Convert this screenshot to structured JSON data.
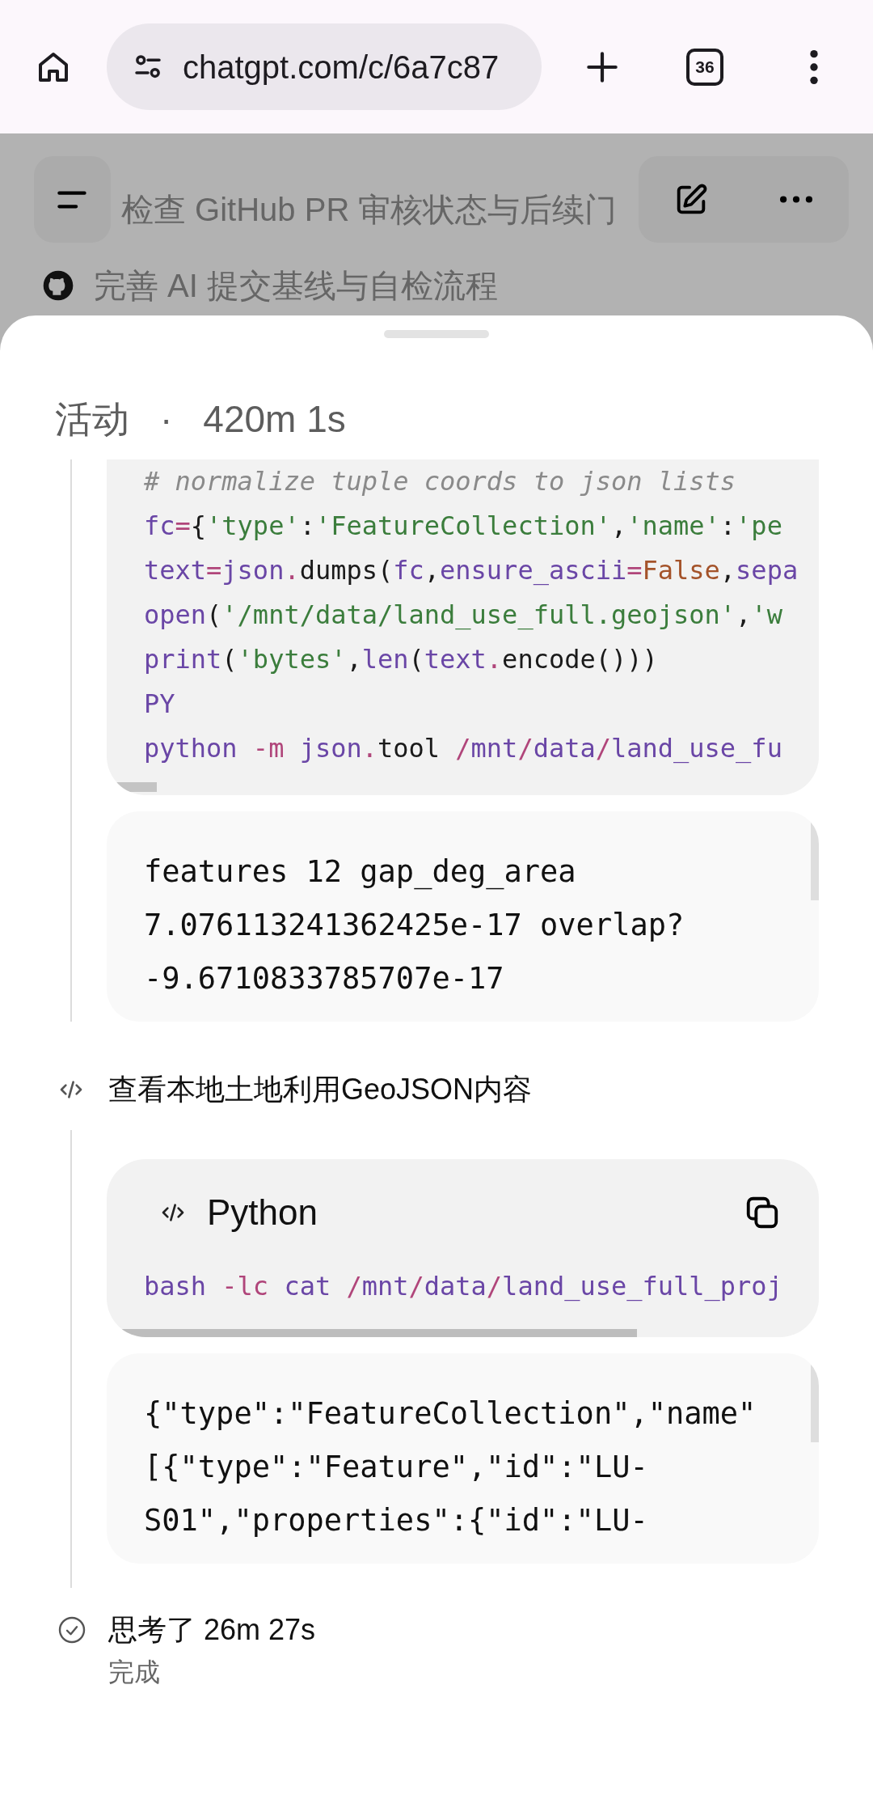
{
  "browser": {
    "url": "chatgpt.com/c/6a7c87",
    "tab_count": "36"
  },
  "background_chat": {
    "items": [
      {
        "kind": "plain",
        "label": "检查 GitHub PR 审核状态与后续门"
      },
      {
        "kind": "github",
        "label": "完善 AI 提交基线与自检流程"
      }
    ]
  },
  "activity_sheet": {
    "title": "活动",
    "separator": "·",
    "duration": "420m 1s",
    "steps": [
      {
        "blocks": [
          {
            "kind": "code",
            "lines": [
              [
                {
                  "kind": "comment",
                  "text": "# normalize tuple coords to json lists"
                }
              ],
              [
                {
                  "kind": "name",
                  "text": "fc"
                },
                {
                  "kind": "op",
                  "text": "="
                },
                {
                  "kind": "plain",
                  "text": "{"
                },
                {
                  "kind": "string",
                  "text": "'type'"
                },
                {
                  "kind": "plain",
                  "text": ":"
                },
                {
                  "kind": "string",
                  "text": "'FeatureCollection'"
                },
                {
                  "kind": "plain",
                  "text": ","
                },
                {
                  "kind": "string",
                  "text": "'name'"
                },
                {
                  "kind": "plain",
                  "text": ":"
                },
                {
                  "kind": "string",
                  "text": "'pe"
                }
              ],
              [
                {
                  "kind": "name",
                  "text": "text"
                },
                {
                  "kind": "op",
                  "text": "="
                },
                {
                  "kind": "name",
                  "text": "json"
                },
                {
                  "kind": "op",
                  "text": "."
                },
                {
                  "kind": "plain",
                  "text": "dumps("
                },
                {
                  "kind": "name",
                  "text": "fc"
                },
                {
                  "kind": "plain",
                  "text": ","
                },
                {
                  "kind": "name",
                  "text": "ensure_ascii"
                },
                {
                  "kind": "op",
                  "text": "="
                },
                {
                  "kind": "const",
                  "text": "False"
                },
                {
                  "kind": "plain",
                  "text": ","
                },
                {
                  "kind": "name",
                  "text": "sepa"
                }
              ],
              [
                {
                  "kind": "name",
                  "text": "open"
                },
                {
                  "kind": "plain",
                  "text": "("
                },
                {
                  "kind": "string",
                  "text": "'/mnt/data/land_use_full.geojson'"
                },
                {
                  "kind": "plain",
                  "text": ","
                },
                {
                  "kind": "string",
                  "text": "'w"
                }
              ],
              [
                {
                  "kind": "name",
                  "text": "print"
                },
                {
                  "kind": "plain",
                  "text": "("
                },
                {
                  "kind": "string",
                  "text": "'bytes'"
                },
                {
                  "kind": "plain",
                  "text": ","
                },
                {
                  "kind": "name",
                  "text": "len"
                },
                {
                  "kind": "plain",
                  "text": "("
                },
                {
                  "kind": "name",
                  "text": "text"
                },
                {
                  "kind": "op",
                  "text": "."
                },
                {
                  "kind": "plain",
                  "text": "encode()))"
                }
              ],
              [
                {
                  "kind": "name",
                  "text": "PY"
                }
              ],
              [
                {
                  "kind": "name",
                  "text": "python"
                },
                {
                  "kind": "op",
                  "text": " -m"
                },
                {
                  "kind": "name",
                  "text": " json"
                },
                {
                  "kind": "op",
                  "text": "."
                },
                {
                  "kind": "plain",
                  "text": "tool "
                },
                {
                  "kind": "op",
                  "text": "/"
                },
                {
                  "kind": "name",
                  "text": "mnt"
                },
                {
                  "kind": "op",
                  "text": "/"
                },
                {
                  "kind": "name",
                  "text": "data"
                },
                {
                  "kind": "op",
                  "text": "/"
                },
                {
                  "kind": "name",
                  "text": "land_use_fu"
                }
              ]
            ]
          },
          {
            "kind": "output",
            "lines": [
              "features 12 gap_deg_area",
              "7.076113241362425e-17 overlap?",
              "-9.6710833785707e-17"
            ]
          }
        ]
      },
      {
        "label": "查看本地土地利用GeoJSON内容",
        "blocks": [
          {
            "kind": "code",
            "language": "Python",
            "lines": [
              [
                {
                  "kind": "name",
                  "text": "bash"
                },
                {
                  "kind": "op",
                  "text": " -lc"
                },
                {
                  "kind": "name",
                  "text": " cat"
                },
                {
                  "kind": "op",
                  "text": " /"
                },
                {
                  "kind": "name",
                  "text": "mnt"
                },
                {
                  "kind": "op",
                  "text": "/"
                },
                {
                  "kind": "name",
                  "text": "data"
                },
                {
                  "kind": "op",
                  "text": "/"
                },
                {
                  "kind": "name",
                  "text": "land_use_full_proj"
                }
              ]
            ]
          },
          {
            "kind": "output",
            "lines": [
              "{\"type\":\"FeatureCollection\",\"name\"",
              "[{\"type\":\"Feature\",\"id\":\"LU-",
              "S01\",\"properties\":{\"id\":\"LU-"
            ]
          }
        ]
      }
    ],
    "done": {
      "label": "思考了 26m 27s",
      "status": "完成"
    }
  }
}
